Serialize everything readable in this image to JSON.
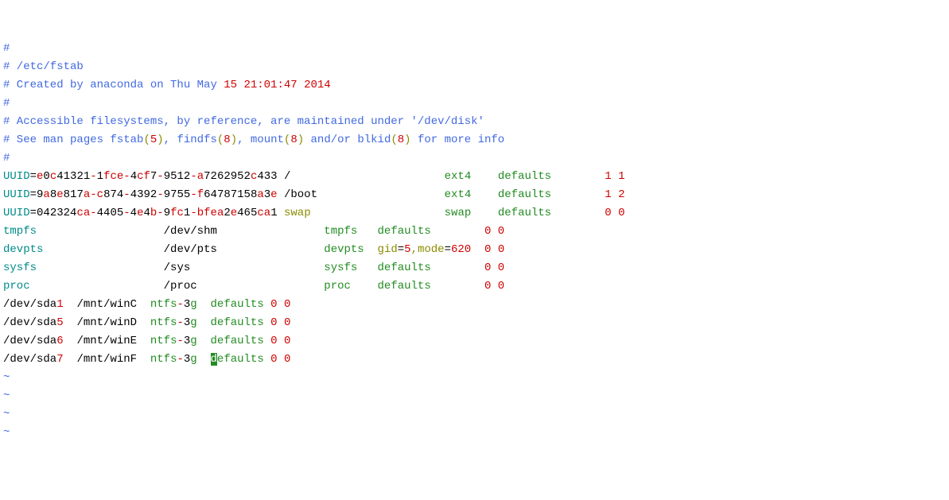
{
  "comments": {
    "c1": "#",
    "c2": "# /etc/fstab",
    "c3_prefix": "# Created by anaconda on Thu May ",
    "c3_date": "15 21:01:47 2014",
    "c4": "#",
    "c5": "# Accessible filesystems, by reference, are maintained under '/dev/disk'",
    "c6_a": "# See man pages fstab",
    "c6_b": ", findfs",
    "c6_c": ", mount",
    "c6_d": " and/or blkid",
    "c6_e": " for more info",
    "c6_p1o": "(",
    "c6_p1n": "5",
    "c6_p1c": ")",
    "c6_p2o": "(",
    "c6_p2n": "8",
    "c6_p2c": ")",
    "c6_p3o": "(",
    "c6_p3n": "8",
    "c6_p3c": ")",
    "c6_p4o": "(",
    "c6_p4n": "8",
    "c6_p4c": ")",
    "c7": "#"
  },
  "uuid": {
    "label": "UUID",
    "eq": "=",
    "u1": {
      "a": "e",
      "b": "0",
      "c": "c",
      "d": "41321",
      "e": "-",
      "f": "1",
      "g": "fce",
      "h": "-",
      "i": "4",
      "j": "cf",
      "k": "7",
      "l": "-",
      "m": "9512",
      "n": "-",
      "o": "a",
      "p": "7262952",
      "q": "c",
      "r": "433",
      "mp": " /",
      "pad1": "                       ",
      "fs": "ext4",
      "pad2": "    ",
      "opt": "defaults",
      "pad3": "        ",
      "d1": "1",
      "sp": " ",
      "d2": "1"
    },
    "u2": {
      "a": "9",
      "b": "a",
      "c": "8",
      "d": "e",
      "e": "817",
      "f": "a",
      "g": "-",
      "h": "c",
      "i": "874",
      "j": "-",
      "k": "4392",
      "l": "-",
      "m": "9755",
      "n": "-",
      "o": "f",
      "p": "64787158",
      "q": "a",
      "r": "3",
      "s": "e",
      "mp": " /boot",
      "pad1": "                   ",
      "fs": "ext4",
      "pad2": "    ",
      "opt": "defaults",
      "pad3": "        ",
      "d1": "1",
      "sp": " ",
      "d2": "2"
    },
    "u3": {
      "a": "042324",
      "b": "ca",
      "c": "-",
      "d": "4405",
      "e": "-",
      "f": "4",
      "g": "e",
      "h": "4",
      "i": "b",
      "j": "-",
      "k": "9",
      "l": "fc",
      "m": "1",
      "n": "-",
      "o": "bfea",
      "p": "2",
      "q": "e",
      "r": "465",
      "s": "ca",
      "t": "1",
      "mp": " ",
      "sw": "swap",
      "pad1": "                    ",
      "fs": "swap",
      "pad2": "    ",
      "opt": "defaults",
      "pad3": "        ",
      "d1": "0",
      "sp": " ",
      "d2": "0"
    }
  },
  "pseudo": {
    "p1": {
      "name": "tmpfs",
      "pad1": "                   ",
      "mp": "/dev/shm",
      "pad2": "                ",
      "fs": "tmpfs",
      "pad3": "   ",
      "opt": "defaults",
      "pad4": "        ",
      "d1": "0",
      "sp": " ",
      "d2": "0"
    },
    "p2": {
      "name": "devpts",
      "pad1": "                  ",
      "mp": "/dev/pts",
      "pad2": "                ",
      "fs": "devpts",
      "pad3": "  ",
      "g": "gid",
      "eq1": "=",
      "v1": "5",
      "com": ",",
      "m": "mode",
      "eq2": "=",
      "v2": "620",
      "pad4": "  ",
      "d1": "0",
      "sp": " ",
      "d2": "0"
    },
    "p3": {
      "name": "sysfs",
      "pad1": "                   ",
      "mp": "/sys",
      "pad2": "                    ",
      "fs": "sysfs",
      "pad3": "   ",
      "opt": "defaults",
      "pad4": "        ",
      "d1": "0",
      "sp": " ",
      "d2": "0"
    },
    "p4": {
      "name": "proc",
      "pad1": "                    ",
      "mp": "/proc",
      "pad2": "                   ",
      "fs": "proc",
      "pad3": "    ",
      "opt": "defaults",
      "pad4": "        ",
      "d1": "0",
      "sp": " ",
      "d2": "0"
    }
  },
  "ntfs": {
    "n1": {
      "dev": "/dev/sda",
      "num": "1",
      "sp1": "  ",
      "mp": "/mnt/winC",
      "sp2": "  ",
      "fs": "ntfs",
      "dash": "-",
      "fs2": "3",
      "fs3": "g",
      "sp3": "  ",
      "opt": "defaults",
      "sp4": " ",
      "d1": "0",
      "sp5": " ",
      "d2": "0"
    },
    "n2": {
      "dev": "/dev/sda",
      "num": "5",
      "sp1": "  ",
      "mp": "/mnt/winD",
      "sp2": "  ",
      "fs": "ntfs",
      "dash": "-",
      "fs2": "3",
      "fs3": "g",
      "sp3": "  ",
      "opt": "defaults",
      "sp4": " ",
      "d1": "0",
      "sp5": " ",
      "d2": "0"
    },
    "n3": {
      "dev": "/dev/sda",
      "num": "6",
      "sp1": "  ",
      "mp": "/mnt/winE",
      "sp2": "  ",
      "fs": "ntfs",
      "dash": "-",
      "fs2": "3",
      "fs3": "g",
      "sp3": "  ",
      "opt": "defaults",
      "sp4": " ",
      "d1": "0",
      "sp5": " ",
      "d2": "0"
    },
    "n4": {
      "dev": "/dev/sda",
      "num": "7",
      "sp1": "  ",
      "mp": "/mnt/winF",
      "sp2": "  ",
      "fs": "ntfs",
      "dash": "-",
      "fs2": "3",
      "fs3": "g",
      "sp3": "  ",
      "cur": "d",
      "opt": "efaults",
      "sp4": " ",
      "d1": "0",
      "sp5": " ",
      "d2": "0"
    }
  },
  "tilde": "~"
}
